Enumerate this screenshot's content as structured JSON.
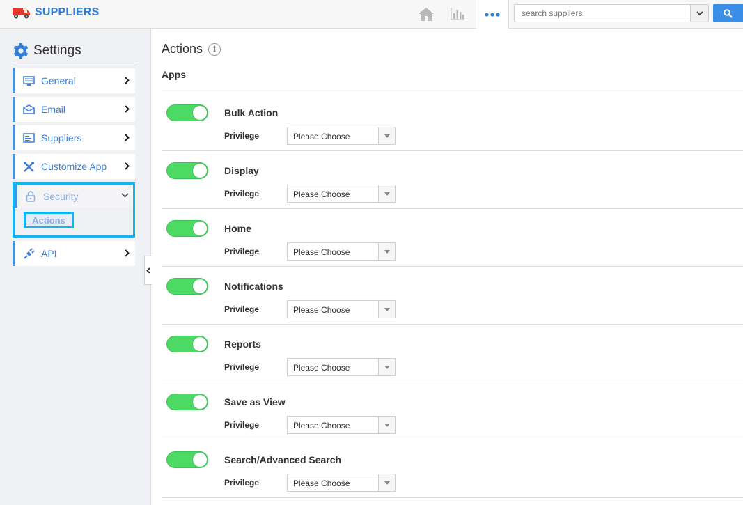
{
  "app": {
    "title": "SUPPLIERS"
  },
  "search": {
    "placeholder": "search suppliers"
  },
  "sidebar": {
    "title": "Settings",
    "items": [
      {
        "label": "General",
        "icon": "monitor-icon"
      },
      {
        "label": "Email",
        "icon": "envelope-icon"
      },
      {
        "label": "Suppliers",
        "icon": "list-icon"
      },
      {
        "label": "Customize App",
        "icon": "tools-icon"
      },
      {
        "label": "Security",
        "icon": "lock-icon",
        "expanded": true,
        "children": [
          {
            "label": "Actions",
            "selected": true
          }
        ]
      },
      {
        "label": "API",
        "icon": "plug-icon"
      }
    ]
  },
  "main": {
    "title": "Actions",
    "section": "Apps",
    "privilege_label": "Privilege",
    "rows": [
      {
        "name": "Bulk Action",
        "enabled": true,
        "privilege": "Please Choose"
      },
      {
        "name": "Display",
        "enabled": true,
        "privilege": "Please Choose"
      },
      {
        "name": "Home",
        "enabled": true,
        "privilege": "Please Choose"
      },
      {
        "name": "Notifications",
        "enabled": true,
        "privilege": "Please Choose"
      },
      {
        "name": "Reports",
        "enabled": true,
        "privilege": "Please Choose"
      },
      {
        "name": "Save as View",
        "enabled": true,
        "privilege": "Please Choose"
      },
      {
        "name": "Search/Advanced Search",
        "enabled": true,
        "privilege": "Please Choose"
      }
    ]
  },
  "colors": {
    "accent": "#2f7fd8",
    "toggle_on": "#4cd964",
    "highlight": "#12b5f0"
  }
}
